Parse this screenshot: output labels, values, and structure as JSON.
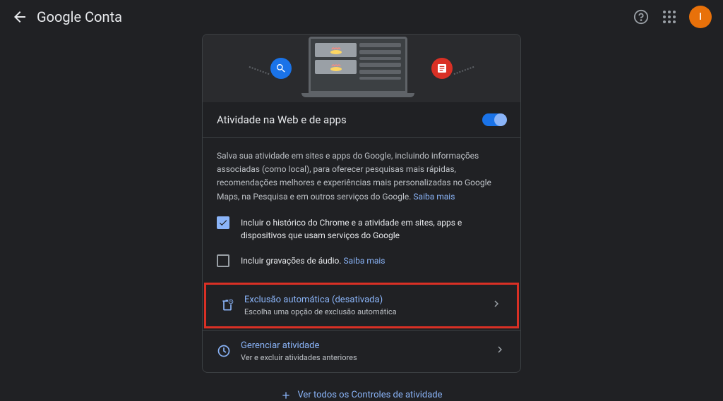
{
  "header": {
    "title": "Google Conta",
    "avatar_letter": "I"
  },
  "card": {
    "title": "Atividade na Web e de apps",
    "description_text": "Salva sua atividade em sites e apps do Google, incluindo informações associadas (como local), para oferecer pesquisas mais rápidas, recomendações melhores e experiências mais personalizadas no Google Maps, na Pesquisa e em outros serviços do Google. ",
    "learn_more": "Saiba mais",
    "checkbox1_label": "Incluir o histórico do Chrome e a atividade em sites, apps e dispositivos que usam serviços do Google",
    "checkbox2_label": "Incluir gravações de áudio. ",
    "checkbox2_link": "Saiba mais",
    "action1": {
      "title": "Exclusão automática (desativada)",
      "subtitle": "Escolha uma opção de exclusão automática"
    },
    "action2": {
      "title": "Gerenciar atividade",
      "subtitle": "Ver e excluir atividades anteriores"
    }
  },
  "footer": {
    "link_text": "Ver todos os Controles de atividade"
  }
}
